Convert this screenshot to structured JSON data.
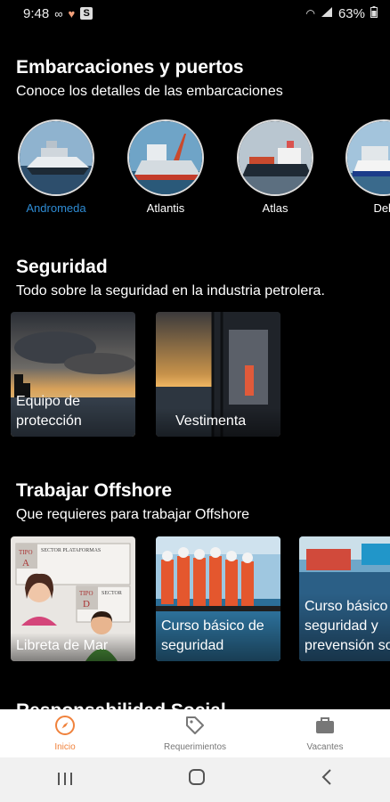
{
  "status_bar": {
    "time": "9:48",
    "battery": "63%"
  },
  "sections": {
    "embarcaciones": {
      "title": "Embarcaciones y puertos",
      "subtitle": "Conoce los detalles de las embarcaciones",
      "items": [
        {
          "label": "Andromeda",
          "active": true
        },
        {
          "label": "Atlantis"
        },
        {
          "label": "Atlas"
        },
        {
          "label": "Delt"
        }
      ]
    },
    "seguridad": {
      "title": "Seguridad",
      "subtitle": "Todo sobre la seguridad en la industria petrolera.",
      "cards": [
        {
          "label": "Equipo de protección"
        },
        {
          "label": "Vestimenta"
        }
      ]
    },
    "offshore": {
      "title": "Trabajar Offshore",
      "subtitle": "Que requieres para trabajar Offshore",
      "cards": [
        {
          "label": "Libreta de Mar",
          "art_text": [
            "TIPO",
            "A",
            "SECTOR PLATAFORMAS",
            "TIPO",
            "D",
            "SECTOR"
          ]
        },
        {
          "label": "Curso básico de seguridad"
        },
        {
          "label": "Curso básico de seguridad y prevensión social"
        }
      ]
    },
    "next": {
      "title": "Responsabilidad Social"
    }
  },
  "bottom_nav": [
    {
      "label": "Inicio",
      "icon": "compass-icon",
      "active": true
    },
    {
      "label": "Requerimientos",
      "icon": "tag-icon"
    },
    {
      "label": "Vacantes",
      "icon": "briefcase-icon"
    }
  ],
  "colors": {
    "accent": "#f0823c",
    "selected_label": "#2e8bd3",
    "background": "#000000"
  }
}
